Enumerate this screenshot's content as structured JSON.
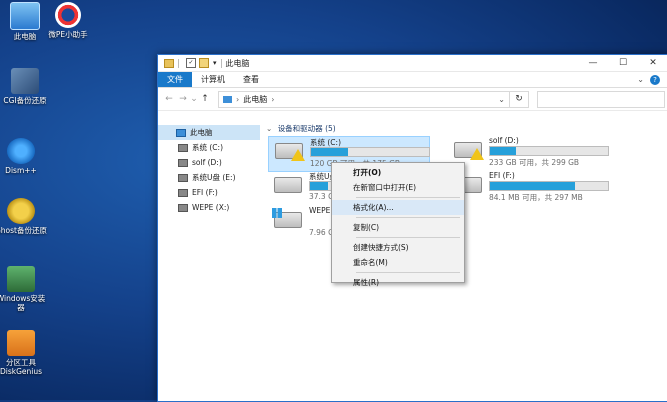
{
  "desktop": {
    "icons": [
      {
        "label": "此电脑"
      },
      {
        "label": "微PE小助手"
      },
      {
        "label": "CGI备份还原"
      },
      {
        "label": "Dism++"
      },
      {
        "label": "Ghost备份还原"
      },
      {
        "label": "Windows安装器"
      },
      {
        "label": "分区工具DiskGenius"
      }
    ]
  },
  "window": {
    "title": "此电脑",
    "controls": {
      "minimize": "—",
      "maximize": "☐",
      "close": "✕"
    },
    "tabs": [
      {
        "label": "文件"
      },
      {
        "label": "计算机"
      },
      {
        "label": "查看"
      }
    ],
    "address": {
      "path": "此电脑",
      "sep": "›",
      "dropdown": "⌄",
      "refresh": "↻"
    },
    "nav": {
      "back": "←",
      "forward": "→",
      "recent": "⌄",
      "up": "↑"
    },
    "help": "?",
    "expand": "⌄",
    "sidebar": [
      {
        "label": "此电脑",
        "selected": true
      },
      {
        "label": "系统 (C:)"
      },
      {
        "label": "solf (D:)"
      },
      {
        "label": "系统U盘 (E:)"
      },
      {
        "label": "EFI (F:)"
      },
      {
        "label": "WEPE (X:)"
      }
    ],
    "group_title": "设备和驱动器 (5)",
    "drives": [
      {
        "name": "系统 (C:)",
        "capacity": "120 GB 可用，共 175 GB",
        "used_fraction": 0.31
      },
      {
        "name": "solf (D:)",
        "capacity": "233 GB 可用，共 299 GB",
        "used_fraction": 0.22
      },
      {
        "name": "系统U盘",
        "capacity": "37.3 GB",
        "used_fraction": 0.15
      },
      {
        "name": "EFI (F:)",
        "capacity": "84.1 MB 可用，共 297 MB",
        "used_fraction": 0.72
      },
      {
        "name": "WEPE (X:)",
        "capacity": "7.96 GB",
        "used_fraction": 0.0
      }
    ]
  },
  "context_menu": {
    "items": [
      {
        "label": "打开(O)",
        "bold": true
      },
      {
        "label": "在新窗口中打开(E)"
      },
      {
        "label": "格式化(A)..."
      },
      {
        "label": "复制(C)"
      },
      {
        "label": "创建快捷方式(S)"
      },
      {
        "label": "重命名(M)"
      },
      {
        "label": "属性(R)"
      }
    ]
  }
}
